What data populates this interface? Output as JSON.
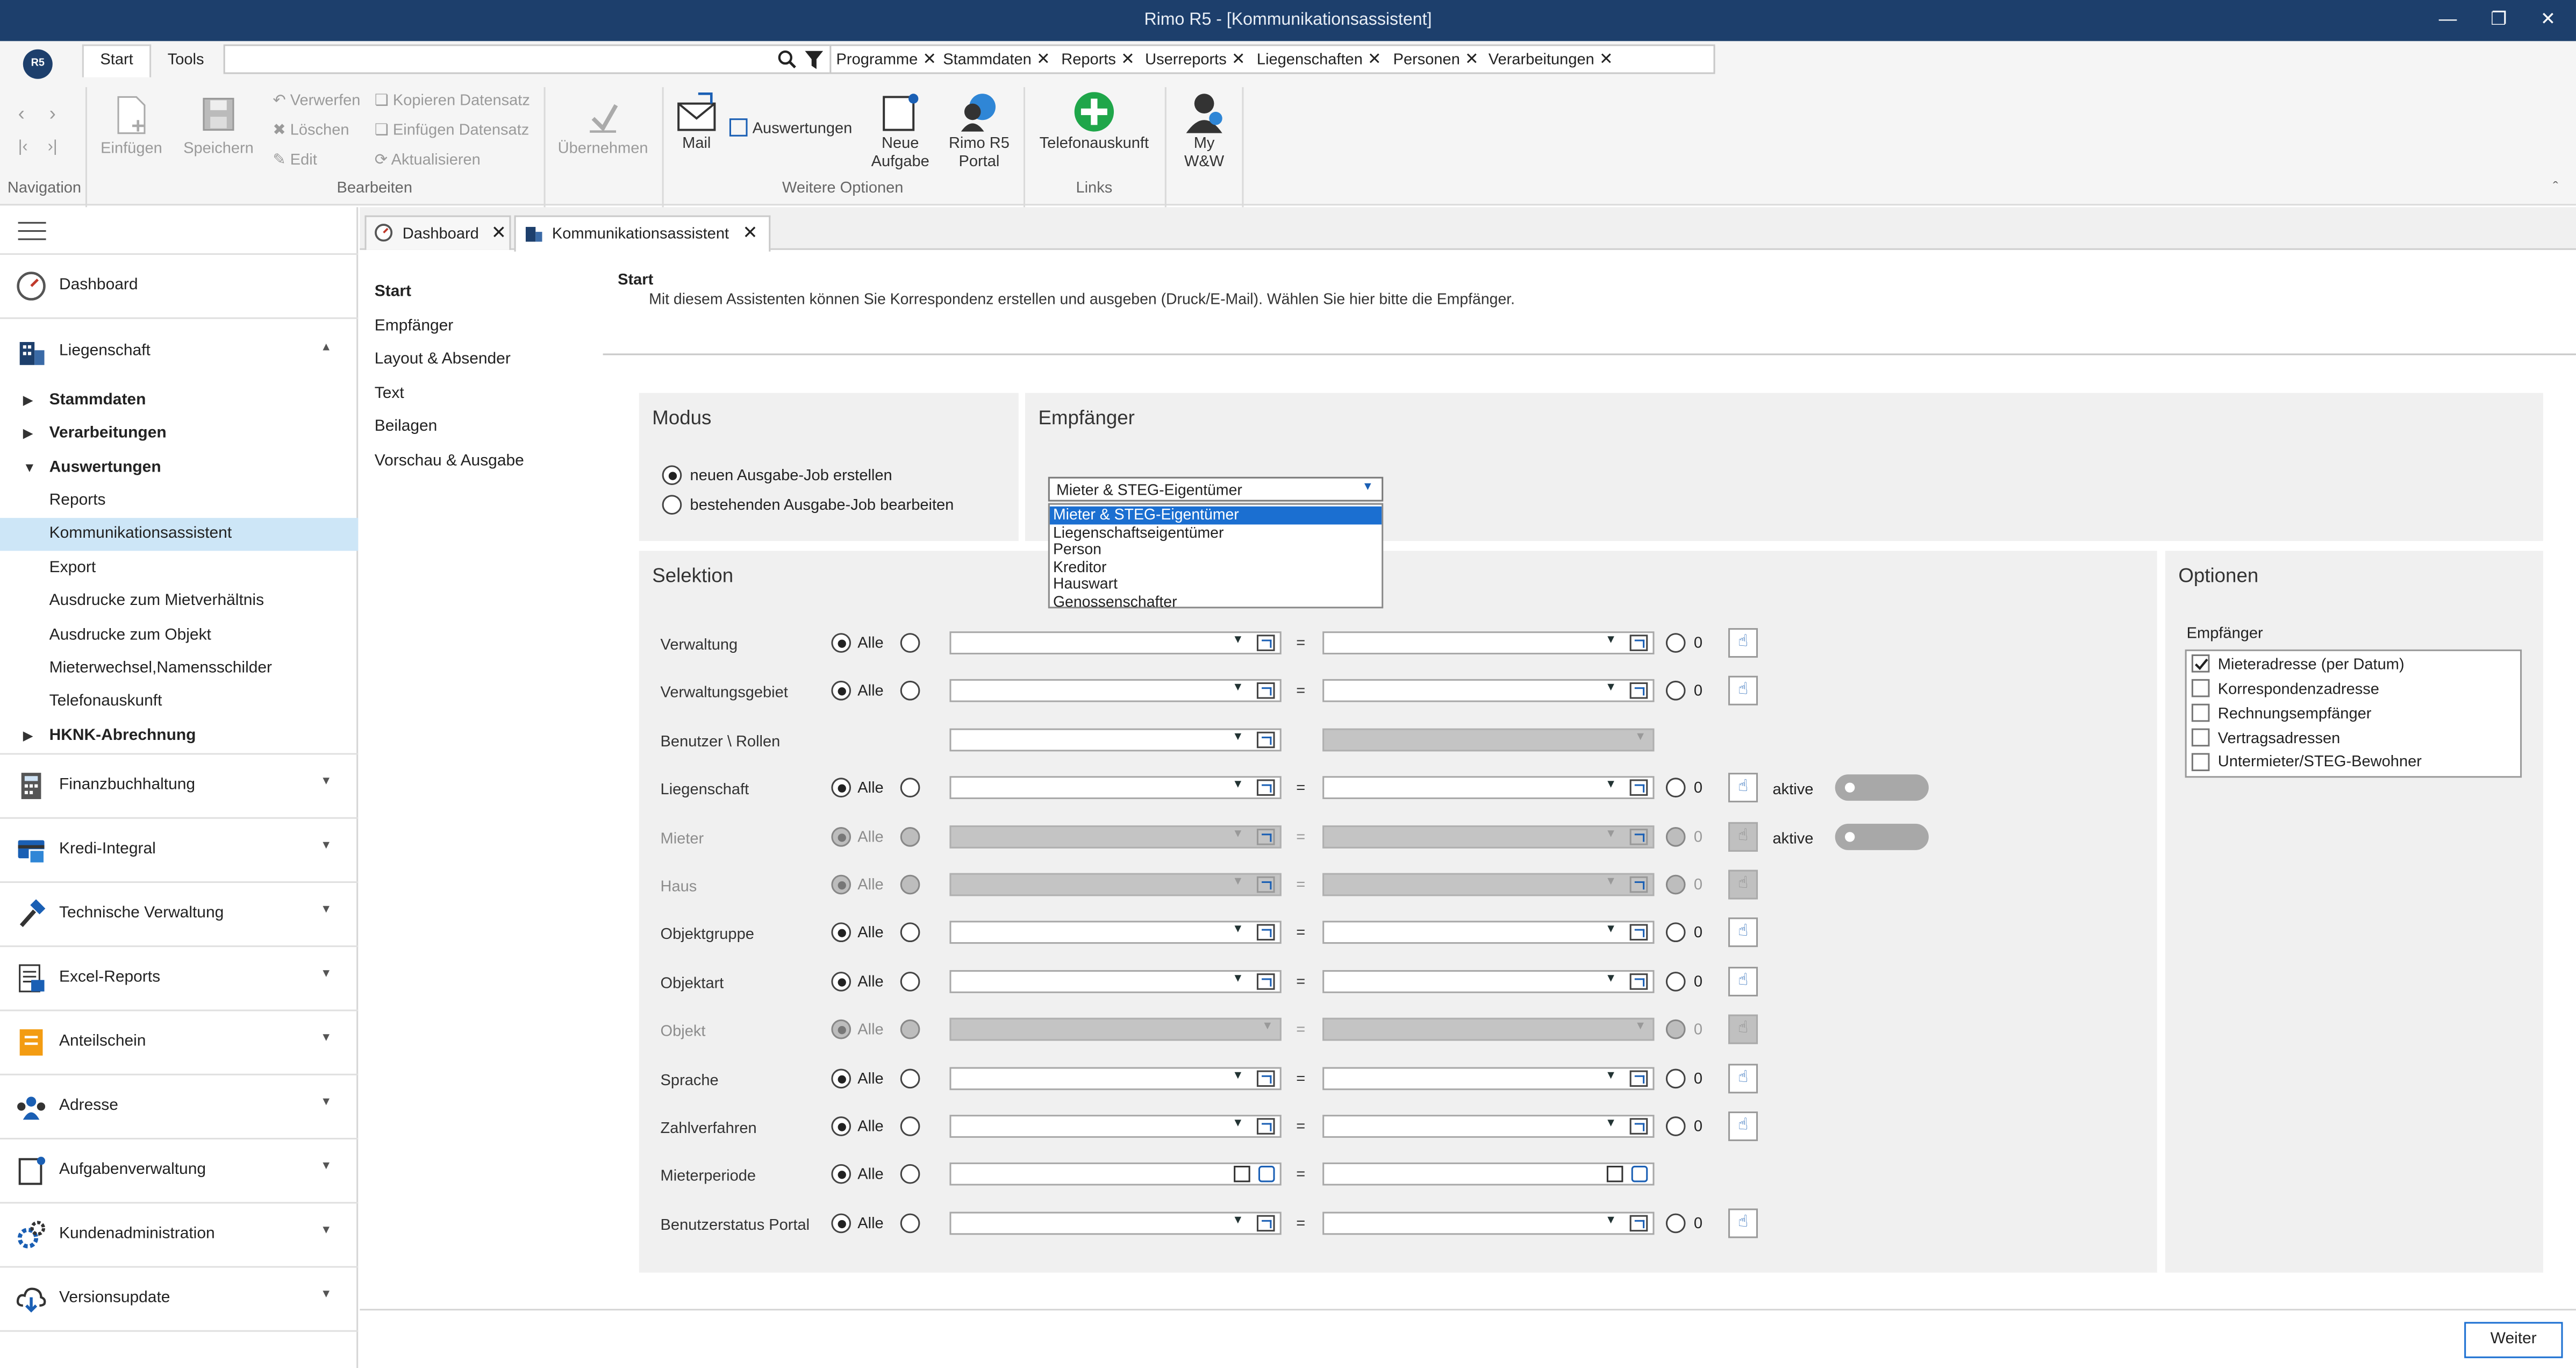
{
  "window": {
    "title": "Rimo R5 - [Kommunikationsassistent]"
  },
  "ribbon": {
    "tabs": [
      "Start",
      "Tools"
    ],
    "chips": [
      "Programme",
      "Stammdaten",
      "Reports",
      "Userreports",
      "Liegenschaften",
      "Personen",
      "Verarbeitungen"
    ],
    "buttons": {
      "einfuegen": "Einfügen",
      "speichern": "Speichern",
      "verwerfen": "Verwerfen",
      "loeschen": "Löschen",
      "edit": "Edit",
      "kopieren": "Kopieren Datensatz",
      "einfuegen_ds": "Einfügen Datensatz",
      "aktualisieren": "Aktualisieren",
      "uebernehmen": "Übernehmen",
      "mail": "Mail",
      "auswertungen": "Auswertungen",
      "neue_aufgabe_1": "Neue",
      "neue_aufgabe_2": "Aufgabe",
      "portal_1": "Rimo R5",
      "portal_2": "Portal",
      "telefon": "Telefonauskunft",
      "myww_1": "My",
      "myww_2": "W&W"
    },
    "groups": {
      "navigation": "Navigation",
      "bearbeiten": "Bearbeiten",
      "weitere": "Weitere Optionen",
      "links": "Links"
    }
  },
  "sidebar": {
    "main": [
      {
        "label": "Dashboard"
      },
      {
        "label": "Liegenschaft"
      },
      {
        "label": "Finanzbuchhaltung"
      },
      {
        "label": "Kredi-Integral"
      },
      {
        "label": "Technische Verwaltung"
      },
      {
        "label": "Excel-Reports"
      },
      {
        "label": "Anteilschein"
      },
      {
        "label": "Adresse"
      },
      {
        "label": "Aufgabenverwaltung"
      },
      {
        "label": "Kundenadministration"
      },
      {
        "label": "Versionsupdate"
      }
    ],
    "sub": [
      {
        "label": "Stammdaten"
      },
      {
        "label": "Verarbeitungen"
      },
      {
        "label": "Auswertungen"
      },
      {
        "label": "Reports"
      },
      {
        "label": "Kommunikationsassistent"
      },
      {
        "label": "Export"
      },
      {
        "label": "Ausdrucke zum Mietverhältnis"
      },
      {
        "label": "Ausdrucke zum Objekt"
      },
      {
        "label": "Mieterwechsel,Namensschilder"
      },
      {
        "label": "Telefonauskunft"
      },
      {
        "label": "HKNK-Abrechnung"
      }
    ]
  },
  "doctabs": [
    "Dashboard",
    "Kommunikationsassistent"
  ],
  "steps": [
    "Start",
    "Empfänger",
    "Layout & Absender",
    "Text",
    "Beilagen",
    "Vorschau & Ausgabe"
  ],
  "header": {
    "title": "Start",
    "description": "Mit diesem Assistenten können Sie Korrespondenz erstellen und ausgeben (Druck/E-Mail). Wählen Sie hier bitte die Empfänger."
  },
  "modus": {
    "title": "Modus",
    "options": [
      "neuen Ausgabe-Job erstellen",
      "bestehenden Ausgabe-Job bearbeiten"
    ]
  },
  "empfaenger": {
    "title": "Empfänger",
    "selected": "Mieter & STEG-Eigentümer",
    "options": [
      "Mieter & STEG-Eigentümer",
      "Liegenschaftseigentümer",
      "Person",
      "Kreditor",
      "Hauswart",
      "Genossenschafter"
    ]
  },
  "selektion": {
    "title": "Selektion",
    "alle": "Alle",
    "eq": "=",
    "zero": "0",
    "aktive": "aktive",
    "rows": [
      {
        "label": "Verwaltung"
      },
      {
        "label": "Verwaltungsgebiet"
      },
      {
        "label": "Benutzer \\ Rollen"
      },
      {
        "label": "Liegenschaft"
      },
      {
        "label": "Mieter"
      },
      {
        "label": "Haus"
      },
      {
        "label": "Objektgruppe"
      },
      {
        "label": "Objektart"
      },
      {
        "label": "Objekt"
      },
      {
        "label": "Sprache"
      },
      {
        "label": "Zahlverfahren"
      },
      {
        "label": "Mieterperiode"
      },
      {
        "label": "Benutzerstatus Portal"
      }
    ]
  },
  "optionen": {
    "title": "Optionen",
    "subtitle": "Empfänger",
    "items": [
      {
        "label": "Mieteradresse (per Datum)",
        "checked": true
      },
      {
        "label": "Korrespondenzadresse",
        "checked": false
      },
      {
        "label": "Rechnungsempfänger",
        "checked": false
      },
      {
        "label": "Vertragsadressen",
        "checked": false
      },
      {
        "label": "Untermieter/STEG-Bewohner",
        "checked": false
      }
    ]
  },
  "footer": {
    "next": "Weiter"
  }
}
